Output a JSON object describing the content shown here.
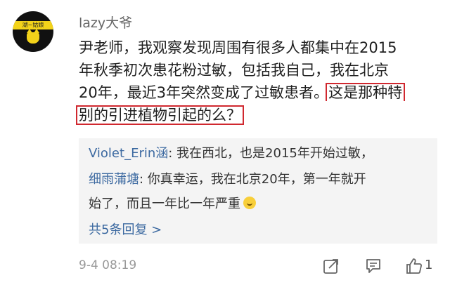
{
  "comment": {
    "avatar_banner": "湖~姑娘",
    "username": "lazy大爷",
    "lines": [
      "尹老师，我观察发现周围有很多人都集中在2015",
      "年秋季初次患花粉过敏，包括我自己，我在北京",
      "20年，最近3年突然变成了过敏患者。"
    ],
    "highlight_part1": "这是那种特",
    "highlight_part2": "别的引进植物引起的么？",
    "timestamp": "9-4 08:19"
  },
  "replies": [
    {
      "user": "Violet_Erin涵",
      "text": ": 我在西北，也是2015年开始过敏，"
    },
    {
      "user": "细雨蒲塘",
      "text": ": 你真幸运，我在北京20年，第一年就开",
      "continuation": "始了，而且一年比一年严重"
    }
  ],
  "more_replies": "共5条回复 >",
  "actions": {
    "share_icon": "share-icon",
    "comment_icon": "comment-icon",
    "like_icon": "thumbs-up-icon",
    "like_count": "1"
  }
}
